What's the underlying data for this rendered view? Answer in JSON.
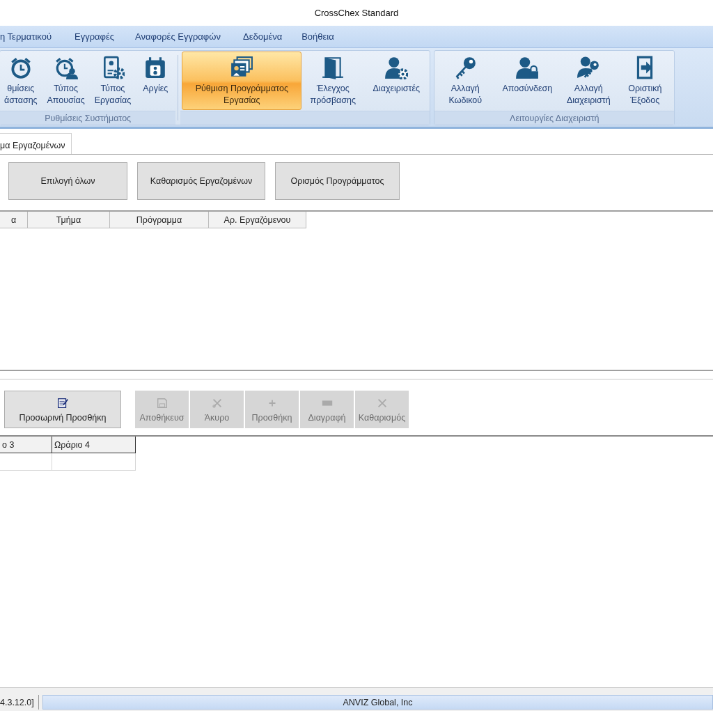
{
  "window": {
    "title": "CrossChex Standard"
  },
  "menu": [
    "η Τερματικού",
    "Εγγραφές",
    "Αναφορές Εγγραφών",
    "Δεδομένα",
    "Βοήθεια"
  ],
  "ribbon": {
    "groups": [
      {
        "label": "Ρυθμίσεις Συστήματος",
        "buttons": [
          {
            "lines": [
              "θμίσεις",
              "άστασης"
            ],
            "selected": false
          },
          {
            "lines": [
              "Τύπος",
              "Απουσίας"
            ],
            "selected": false
          },
          {
            "lines": [
              "Τύπος",
              "Εργασίας"
            ],
            "selected": false
          },
          {
            "lines": [
              "Αργίες"
            ],
            "selected": false
          }
        ],
        "extra_buttons": [
          {
            "lines": [
              "Ρύθμιση Προγράμματος",
              "Εργασίας"
            ],
            "selected": true
          },
          {
            "lines": [
              "Έλεγχος",
              "πρόσβασης"
            ],
            "selected": false
          },
          {
            "lines": [
              "Διαχειριστές"
            ],
            "selected": false
          }
        ]
      },
      {
        "label": "Λειτουργίες Διαχειριστή",
        "buttons": [
          {
            "lines": [
              "Αλλαγή",
              "Κωδικού"
            ],
            "selected": false
          },
          {
            "lines": [
              "Αποσύνδεση"
            ],
            "selected": false
          },
          {
            "lines": [
              "Αλλαγή",
              "Διαχειριστή"
            ],
            "selected": false
          },
          {
            "lines": [
              "Οριστική",
              "Έξοδος"
            ],
            "selected": false
          }
        ]
      }
    ]
  },
  "tabs": [
    {
      "label": "μα Εργαζομένων",
      "selected": true
    }
  ],
  "actions": [
    "Επιλογή όλων",
    "Καθαρισμός Εργαζομένων",
    "Ορισμός Προγράμματος"
  ],
  "employee_table": {
    "columns": [
      "α",
      "Τμήμα",
      "Πρόγραμμα",
      "Αρ. Εργαζόμενου"
    ]
  },
  "toolbar": [
    {
      "label": "Προσωρινή Προσθήκη",
      "disabled": false
    },
    {
      "label": "Αποθήκευσ",
      "disabled": true
    },
    {
      "label": "Άκυρο",
      "disabled": true
    },
    {
      "label": "Προσθήκη",
      "disabled": true
    },
    {
      "label": "Διαγραφή",
      "disabled": true
    },
    {
      "label": "Καθαρισμός",
      "disabled": true
    }
  ],
  "schedule_table": {
    "columns": [
      "ο 3",
      "Ωράριο 4"
    ]
  },
  "status_bar": {
    "version": "4.3.12.0]",
    "company": "ANVIZ Global, Inc"
  }
}
